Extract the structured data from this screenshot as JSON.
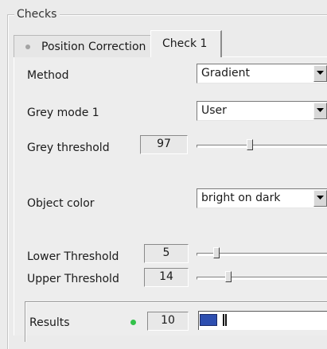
{
  "group": {
    "title": "Checks"
  },
  "tabs": [
    {
      "label": "Position Correction",
      "active": false
    },
    {
      "label": "Check 1",
      "active": true
    }
  ],
  "method": {
    "label": "Method",
    "value": "Gradient"
  },
  "grey_mode": {
    "label": "Grey mode 1",
    "value": "User"
  },
  "grey_threshold": {
    "label": "Grey threshold",
    "value": "97",
    "slider_fraction": 0.39
  },
  "object_color": {
    "label": "Object color",
    "value": "bright on dark"
  },
  "lower_threshold": {
    "label": "Lower Threshold",
    "value": "5",
    "slider_fraction": 0.13
  },
  "upper_threshold": {
    "label": "Upper Threshold",
    "value": "14",
    "slider_fraction": 0.22
  },
  "results": {
    "label": "Results",
    "value": "10",
    "status_color": "#33c24a",
    "bar_fraction": 0.13
  },
  "icons": {
    "dropdown": "chevron-down-icon",
    "tab_indicator": "status-dot-icon",
    "result_indicator": "status-led-icon"
  }
}
